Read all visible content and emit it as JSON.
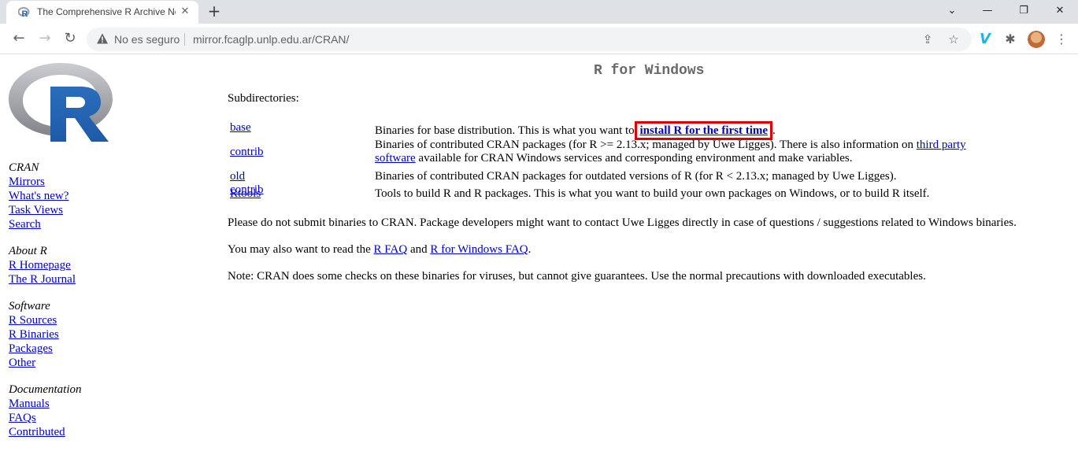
{
  "browser": {
    "tab_title": "The Comprehensive R Archive Network",
    "tab_close_glyph": "✕",
    "new_tab_glyph": "+",
    "security_label": "No es seguro",
    "url": "mirror.fcaglp.unlp.edu.ar/CRAN/",
    "window_controls": {
      "tab_search": "⌄",
      "minimize": "—",
      "restore": "❐",
      "close": "✕"
    },
    "nav": {
      "back": "←",
      "forward": "→",
      "reload": "↻"
    },
    "omnibox_icons": {
      "share": "⇪",
      "bookmark": "☆"
    },
    "extensions": {
      "vimeo": "V",
      "puzzle": "✱",
      "menu": "⋮"
    }
  },
  "sidebar": {
    "groups": [
      {
        "heading": "CRAN",
        "links": [
          "Mirrors",
          "What's new?",
          "Task Views",
          "Search"
        ]
      },
      {
        "heading": "About R",
        "links": [
          "R Homepage",
          "The R Journal"
        ]
      },
      {
        "heading": "Software",
        "links": [
          "R Sources",
          "R Binaries",
          "Packages",
          "Other"
        ]
      },
      {
        "heading": "Documentation",
        "links": [
          "Manuals",
          "FAQs",
          "Contributed"
        ]
      }
    ]
  },
  "main": {
    "heading": "R for Windows",
    "subdirectories_label": "Subdirectories:",
    "rows": [
      {
        "name": "base",
        "desc_pre": "Binaries for base distribution. This is what you want to ",
        "desc_link": "install R for the first time",
        "desc_post": "."
      },
      {
        "name": "contrib",
        "desc_pre": "Binaries of contributed CRAN packages (for R >= 2.13.x; managed by Uwe Ligges). There is also information on ",
        "desc_link": "third party software",
        "desc_post": " available for CRAN Windows services and corresponding environment and make variables."
      },
      {
        "name": "old contrib",
        "desc": "Binaries of contributed CRAN packages for outdated versions of R (for R < 2.13.x; managed by Uwe Ligges)."
      },
      {
        "name": "Rtools",
        "desc": "Tools to build R and R packages. This is what you want to build your own packages on Windows, or to build R itself."
      }
    ],
    "para_submit": "Please do not submit binaries to CRAN. Package developers might want to contact Uwe Ligges directly in case of questions / suggestions related to Windows binaries.",
    "para_faq": {
      "pre": "You may also want to read the ",
      "link1": "R FAQ",
      "mid": " and ",
      "link2": "R for Windows FAQ",
      "post": "."
    },
    "para_note": "Note: CRAN does some checks on these binaries for viruses, but cannot give guarantees. Use the normal precautions with downloaded executables."
  },
  "colors": {
    "link": "#0000cc",
    "heading_gray": "#696969",
    "highlight_border": "#e00000",
    "tabstrip": "#dee1e6"
  }
}
